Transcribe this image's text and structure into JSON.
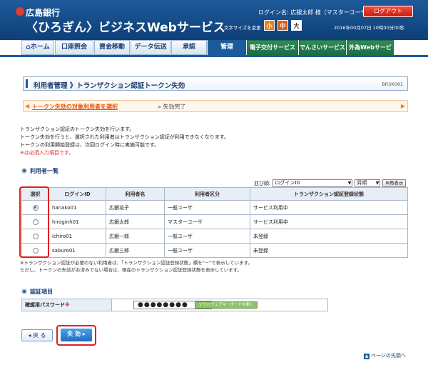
{
  "header": {
    "bank_name": "広島銀行",
    "service_name": "〈ひろぎん〉ビジネスWebサービス",
    "login_name": "ログイン名: 広銀太郎 様（マスターユーザ）",
    "logout_label": "ログアウト",
    "font_size_label": "文字サイズを変更",
    "font_sizes": [
      "小",
      "中",
      "大"
    ],
    "datetime": "2016年00月07日 10時00分00秒"
  },
  "nav": {
    "tabs": [
      "ホーム",
      "口座照会",
      "資金移動",
      "データ伝送",
      "承認",
      "管理",
      "電子交付サービス",
      "でんさいサービス",
      "外為Webサービス"
    ],
    "active": "管理"
  },
  "page": {
    "title": "利用者管理 》トランザクション認証トークン失効",
    "screen_id": "BRSK081",
    "step_active": "トークン失効の対象利用者を選択",
    "step_next": "失効完了",
    "description": [
      "トランザクション認証のトークン失効を行います。",
      "トークン失効を行うと、選択された利用者はトランザクション認証が利用できなくなります。",
      "トークンの利用開始登録は、次回ログイン時に実施可能です。"
    ],
    "required_note": "※は必須入力項目です。"
  },
  "users_section": {
    "title": "利用者一覧",
    "sort_label": "並び順:",
    "sort_field": "ログインID",
    "sort_order": "昇順",
    "reshow_label": "再表示",
    "columns": [
      "選択",
      "ログインID",
      "利用者名",
      "利用者区分",
      "トランザクション認証登録状態"
    ],
    "rows": [
      {
        "login_id": "hanako01",
        "name": "広銀花子",
        "type": "一般ユーザ",
        "status": "サービス利用中",
        "selected": true
      },
      {
        "login_id": "hiroginh01",
        "name": "広銀太郎",
        "type": "マスターユーザ",
        "status": "サービス利用中",
        "selected": false
      },
      {
        "login_id": "ichiro01",
        "name": "広銀一郎",
        "type": "一般ユーザ",
        "status": "未登録",
        "selected": false
      },
      {
        "login_id": "saburo01",
        "name": "広銀三郎",
        "type": "一般ユーザ",
        "status": "未登録",
        "selected": false
      }
    ],
    "notes": [
      "※トランザクション認証が必要のない利用者は、「トランザクション認証登録状態」欄を\"－\"で表示しています。",
      "ただし、トークンの失効がお済みでない場合は、現在のトランザクション認証登録状態を表示しています。"
    ]
  },
  "auth_section": {
    "title": "認証項目",
    "password_label": "確認用パスワード",
    "password_mark": "※",
    "password_value": "●●●●●●●●",
    "keyboard_label": "ソフトウェアキーボードを開く"
  },
  "actions": {
    "back_label": "戻 る",
    "execute_label": "失 効",
    "page_top_label": "ページの先頭へ"
  }
}
